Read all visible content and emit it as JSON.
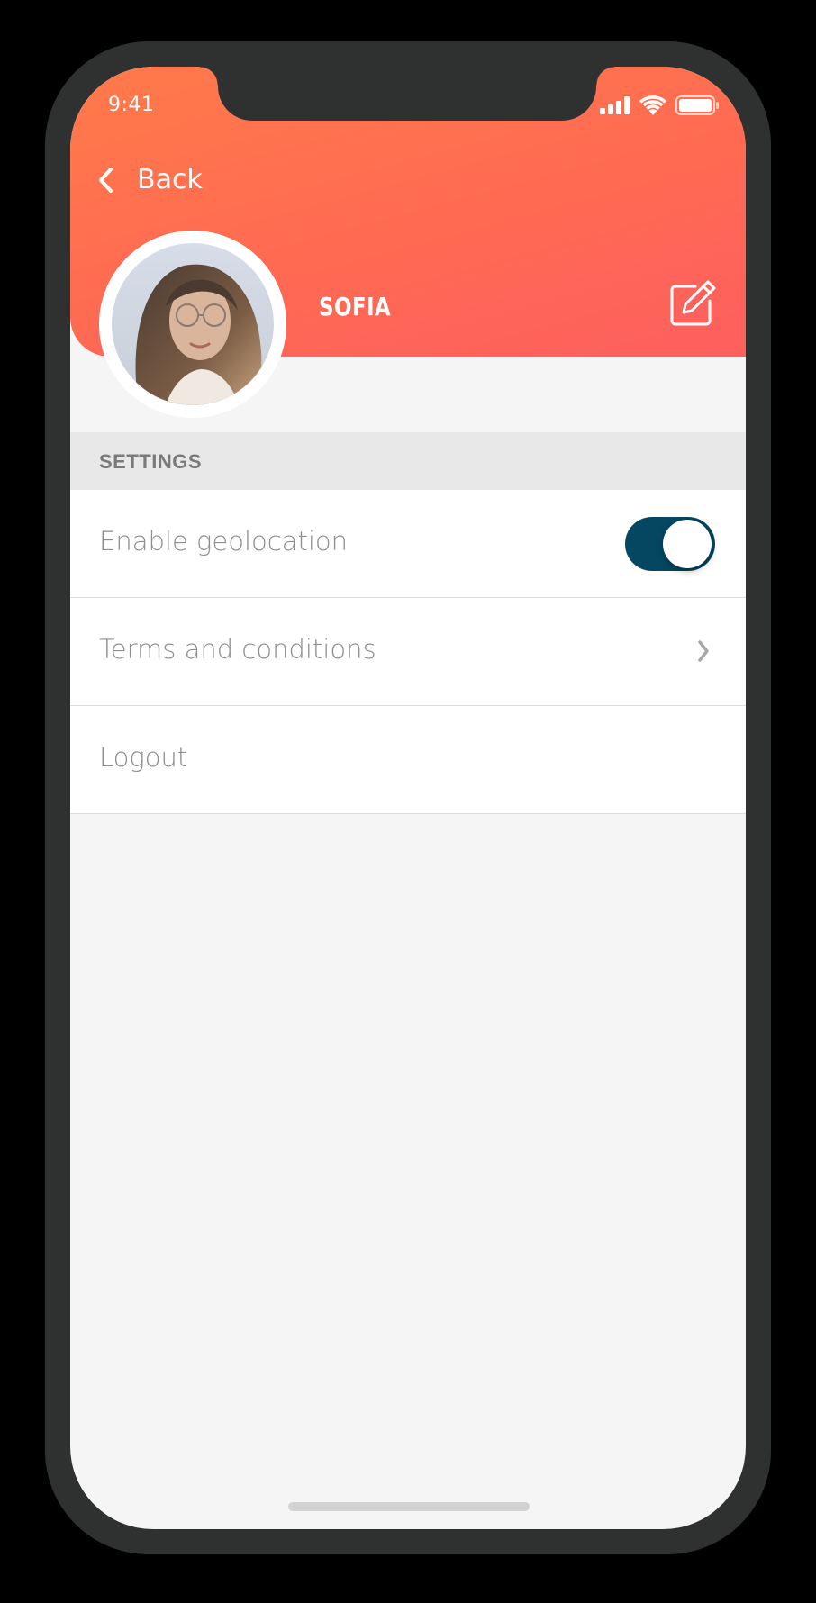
{
  "status_bar": {
    "time": "9:41"
  },
  "nav": {
    "back_label": "Back"
  },
  "profile": {
    "name": "SOFIA"
  },
  "settings": {
    "section_title": "SETTINGS",
    "items": [
      {
        "label": "Enable geolocation",
        "control": "toggle",
        "toggle_on": true
      },
      {
        "label": "Terms and conditions",
        "control": "chevron"
      },
      {
        "label": "Logout",
        "control": "none"
      }
    ]
  },
  "colors": {
    "header_gradient_start": "#ff7a4a",
    "header_gradient_end": "#fe5f5f",
    "toggle_on": "#054761",
    "background": "#f5f5f5"
  },
  "icons": [
    "signal-icon",
    "wifi-icon",
    "battery-icon",
    "back-chevron-icon",
    "edit-icon",
    "chevron-right-icon"
  ]
}
